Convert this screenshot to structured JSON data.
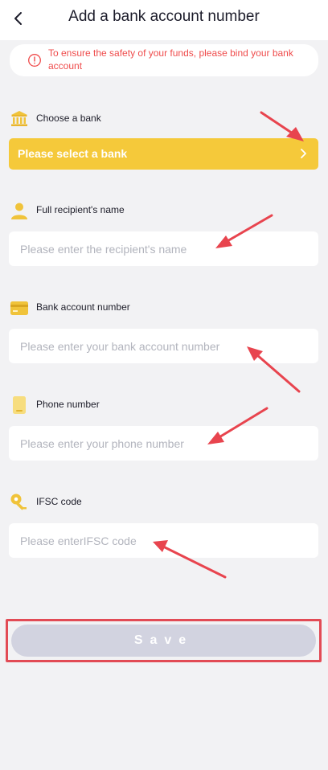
{
  "header": {
    "title": "Add a bank account number",
    "back_icon": "chevron-left-icon"
  },
  "notice": {
    "text": "To ensure the safety of your funds, please bind your bank account",
    "icon": "alert-circle-icon",
    "color": "#ef4b4b"
  },
  "bank": {
    "label": "Choose a bank",
    "icon": "bank-icon",
    "select_text": "Please select a bank",
    "accent": "#f5c93a"
  },
  "recipient": {
    "label": "Full recipient's name",
    "icon": "user-icon",
    "placeholder": "Please enter the recipient's name",
    "value": ""
  },
  "account": {
    "label": "Bank account number",
    "icon": "card-icon",
    "placeholder": "Please enter your bank account number",
    "value": ""
  },
  "phone": {
    "label": "Phone number",
    "icon": "phone-icon",
    "placeholder": "Please enter your phone number",
    "value": ""
  },
  "ifsc": {
    "label": "IFSC code",
    "icon": "key-icon",
    "placeholder": "Please enterIFSC code",
    "value": ""
  },
  "save": {
    "label": "Save",
    "highlight_color": "#e24b55"
  },
  "annotation": {
    "arrow_color": "#e8444e"
  }
}
